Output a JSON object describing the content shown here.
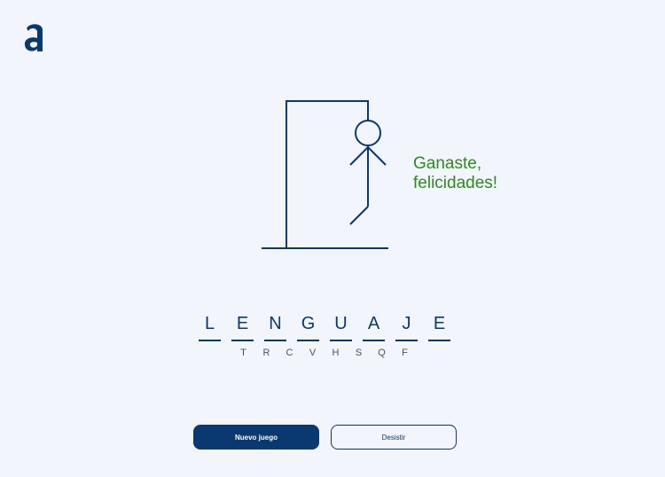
{
  "brand": {
    "logo_icon": "alura-a-logo-icon",
    "color": "#0a3871"
  },
  "game": {
    "message": "Ganaste, felicidades!",
    "message_color": "#2e8a1e",
    "word_letters": [
      "L",
      "E",
      "N",
      "G",
      "U",
      "A",
      "J",
      "E"
    ],
    "wrong_letters": [
      "T",
      "R",
      "C",
      "V",
      "H",
      "S",
      "Q",
      "F"
    ]
  },
  "buttons": {
    "new_game": "Nuevo juego",
    "give_up": "Desistir"
  }
}
